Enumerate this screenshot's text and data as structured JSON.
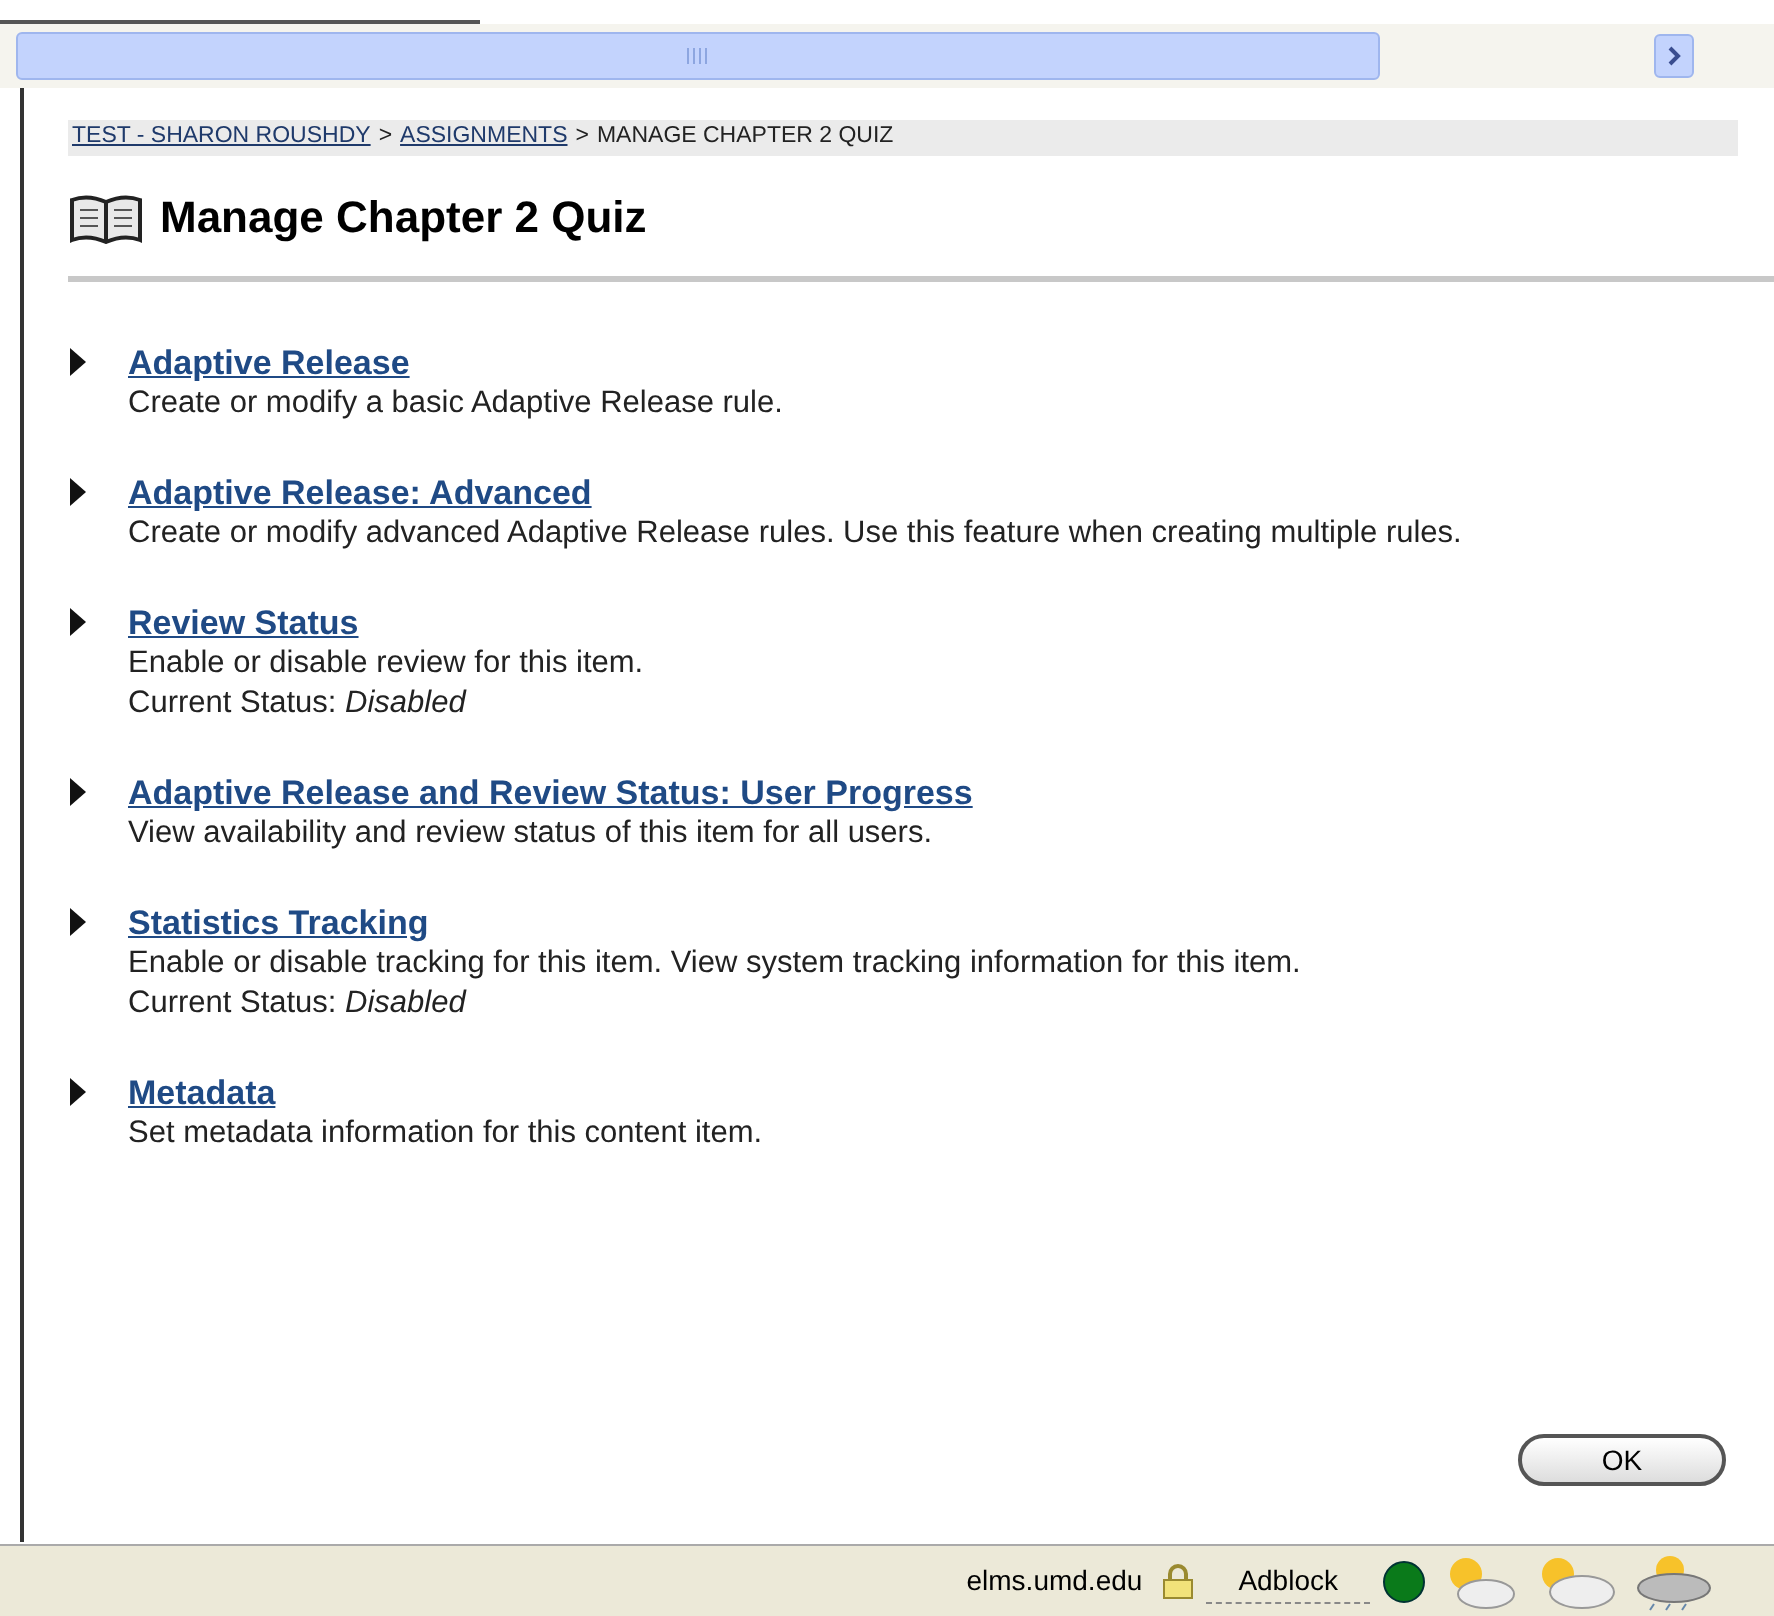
{
  "breadcrumb": [
    {
      "text": "TEST - SHARON ROUSHDY",
      "kind": "link"
    },
    {
      "text": ">",
      "kind": "separator"
    },
    {
      "text": "ASSIGNMENTS",
      "kind": "link"
    },
    {
      "text": ">",
      "kind": "separator"
    },
    {
      "text": "MANAGE CHAPTER 2 QUIZ",
      "kind": "current"
    }
  ],
  "title": "Manage Chapter 2 Quiz",
  "items": [
    {
      "title": "Adaptive Release",
      "description": "Create or modify a basic Adaptive Release rule."
    },
    {
      "title": "Adaptive Release: Advanced",
      "description": "Create or modify advanced Adaptive Release rules. Use this feature when creating multiple rules."
    },
    {
      "title": "Review Status",
      "description": "Enable or disable review for this item.",
      "status": "Current Status: *Disabled*"
    },
    {
      "title": "Adaptive Release and Review Status: User Progress",
      "description": "View availability and review status of this item for all users."
    },
    {
      "title": "Statistics Tracking",
      "description": "Enable or disable tracking for this item. View system tracking information for this item.",
      "status": "Current Status: *Disabled*"
    },
    {
      "title": "Metadata",
      "description": "Set metadata information for this content item."
    }
  ],
  "ok_button": "OK",
  "status_bar": {
    "domain": "elms.umd.edu",
    "adblock": "Adblock"
  }
}
